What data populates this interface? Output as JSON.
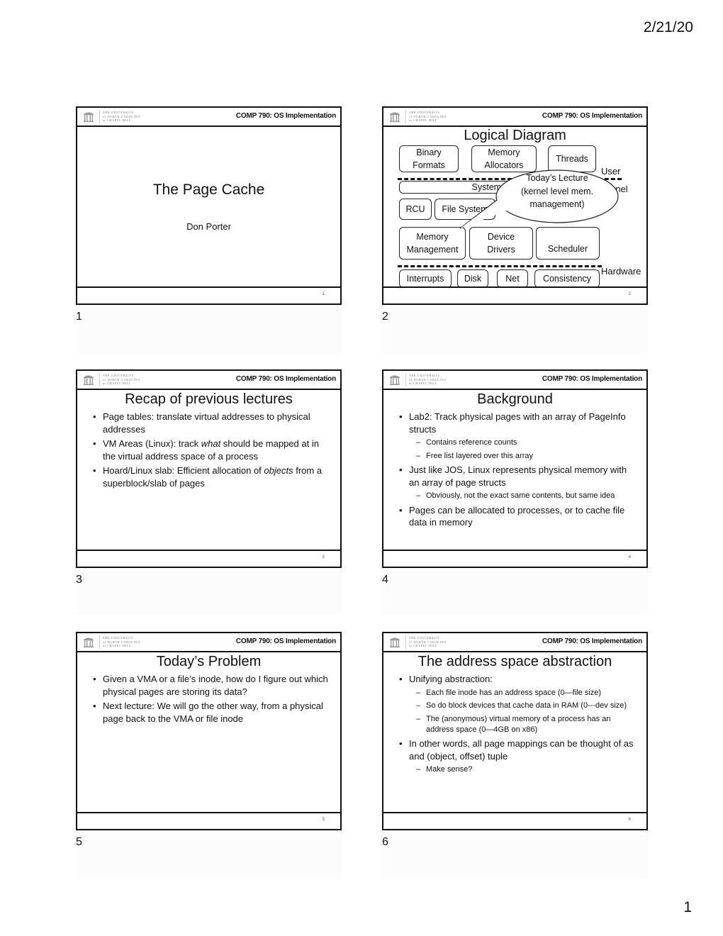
{
  "page": {
    "date": "2/21/20",
    "page_number": "1"
  },
  "common": {
    "course_label": "COMP 790: OS Implementation",
    "logo_lines": [
      "THE UNIVERSITY",
      "of NORTH CAROLINA",
      "at CHAPEL HILL"
    ],
    "logo_icon": "old-well-icon"
  },
  "slides": [
    {
      "number": "1",
      "label": "1",
      "title": "The Page Cache",
      "author": "Don Porter"
    },
    {
      "number": "2",
      "label": "2",
      "title": "Logical Diagram",
      "diagram": {
        "user_boxes": [
          {
            "text": "Binary\nFormats"
          },
          {
            "text": "Memory\nAllocators"
          },
          {
            "text": "Threads"
          }
        ],
        "user_label": "User",
        "kernel_label": "Kernel",
        "hardware_label": "Hardware",
        "system_calls": "System Calls",
        "kernel_boxes_row1": [
          "RCU",
          "File System"
        ],
        "kernel_boxes_row2": [
          "Memory\nManagement",
          "Device\nDrivers",
          "Scheduler"
        ],
        "hardware_boxes": [
          "Interrupts",
          "Disk",
          "Net",
          "Consistency"
        ],
        "callout": "Today’s Lecture\n(kernel level mem.\nmanagement)"
      }
    },
    {
      "number": "3",
      "label": "3",
      "title": "Recap of previous lectures",
      "bullets": [
        {
          "level": 1,
          "html": "Page tables: translate virtual addresses to physical addresses"
        },
        {
          "level": 1,
          "html": "VM Areas (Linux): track <i>what</i> should be mapped at in the virtual address space of a process"
        },
        {
          "level": 1,
          "html": "Hoard/Linux slab: Efficient allocation of <i>objects</i> from a superblock/slab of pages"
        }
      ]
    },
    {
      "number": "4",
      "label": "4",
      "title": "Background",
      "bullets": [
        {
          "level": 1,
          "html": "Lab2: Track physical pages with an array of PageInfo structs"
        },
        {
          "level": 2,
          "html": "Contains reference counts"
        },
        {
          "level": 2,
          "html": "Free list layered over this array"
        },
        {
          "level": 1,
          "html": "Just like JOS, Linux represents physical memory with an array of page structs"
        },
        {
          "level": 2,
          "html": "Obviously, not the exact same contents, but same idea"
        },
        {
          "level": 1,
          "html": "Pages can be allocated to processes, or to cache file data in memory"
        }
      ]
    },
    {
      "number": "5",
      "label": "5",
      "title": "Today’s Problem",
      "bullets": [
        {
          "level": 1,
          "html": "Given a VMA or a file’s inode, how do I figure out which physical pages are storing its data?"
        },
        {
          "level": 1,
          "html": "Next lecture: We will go the other way, from a physical page back to the VMA or file inode"
        }
      ]
    },
    {
      "number": "6",
      "label": "6",
      "title": "The address space abstraction",
      "bullets": [
        {
          "level": 1,
          "html": "Unifying abstraction:"
        },
        {
          "level": 2,
          "html": "Each file inode has an address space (0—file size)"
        },
        {
          "level": 2,
          "html": "So do block devices that cache data in RAM (0---dev size)"
        },
        {
          "level": 2,
          "html": "The (anonymous) virtual memory of a process has an address space (0—4GB on x86)"
        },
        {
          "level": 1,
          "html": "In other words, all page mappings can be thought of as and (object, offset) tuple"
        },
        {
          "level": 2,
          "html": "Make sense?"
        }
      ]
    }
  ]
}
